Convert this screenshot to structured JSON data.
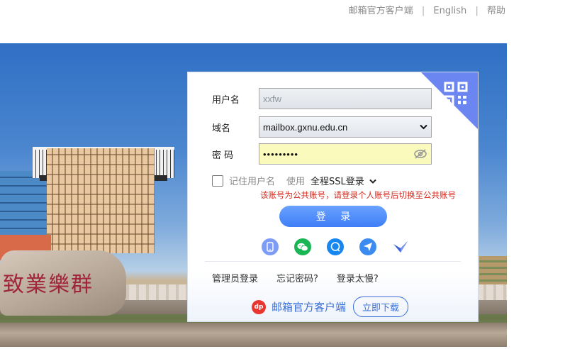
{
  "top_links": {
    "client": "邮箱官方客户端",
    "english": "English",
    "help": "帮助",
    "separator": "|"
  },
  "scene": {
    "stone_text": "致業樂群"
  },
  "login": {
    "username_label": "用户名",
    "username_value": "xxfw",
    "domain_label": "域名",
    "domain_value": "mailbox.gxnu.edu.cn",
    "password_label": "密 码",
    "password_value": "•••••••••",
    "remember_label": "记住用户名",
    "use_label": "使用",
    "ssl_label": "全程SSL登录",
    "warning": "该账号为公共账号，请登录个人账号后切换至公共账号",
    "login_button": "登 录",
    "admin_login": "管理员登录",
    "forgot_password": "忘记密码?",
    "slow_login": "登录太慢?",
    "client_text": "邮箱官方客户端",
    "download_button": "立即下载",
    "client_logo_text": "dp"
  },
  "colors": {
    "accent": "#3f7ef7",
    "warning": "#d0291f",
    "qr_corner": "#6b86f0",
    "wechat": "#19b653"
  }
}
